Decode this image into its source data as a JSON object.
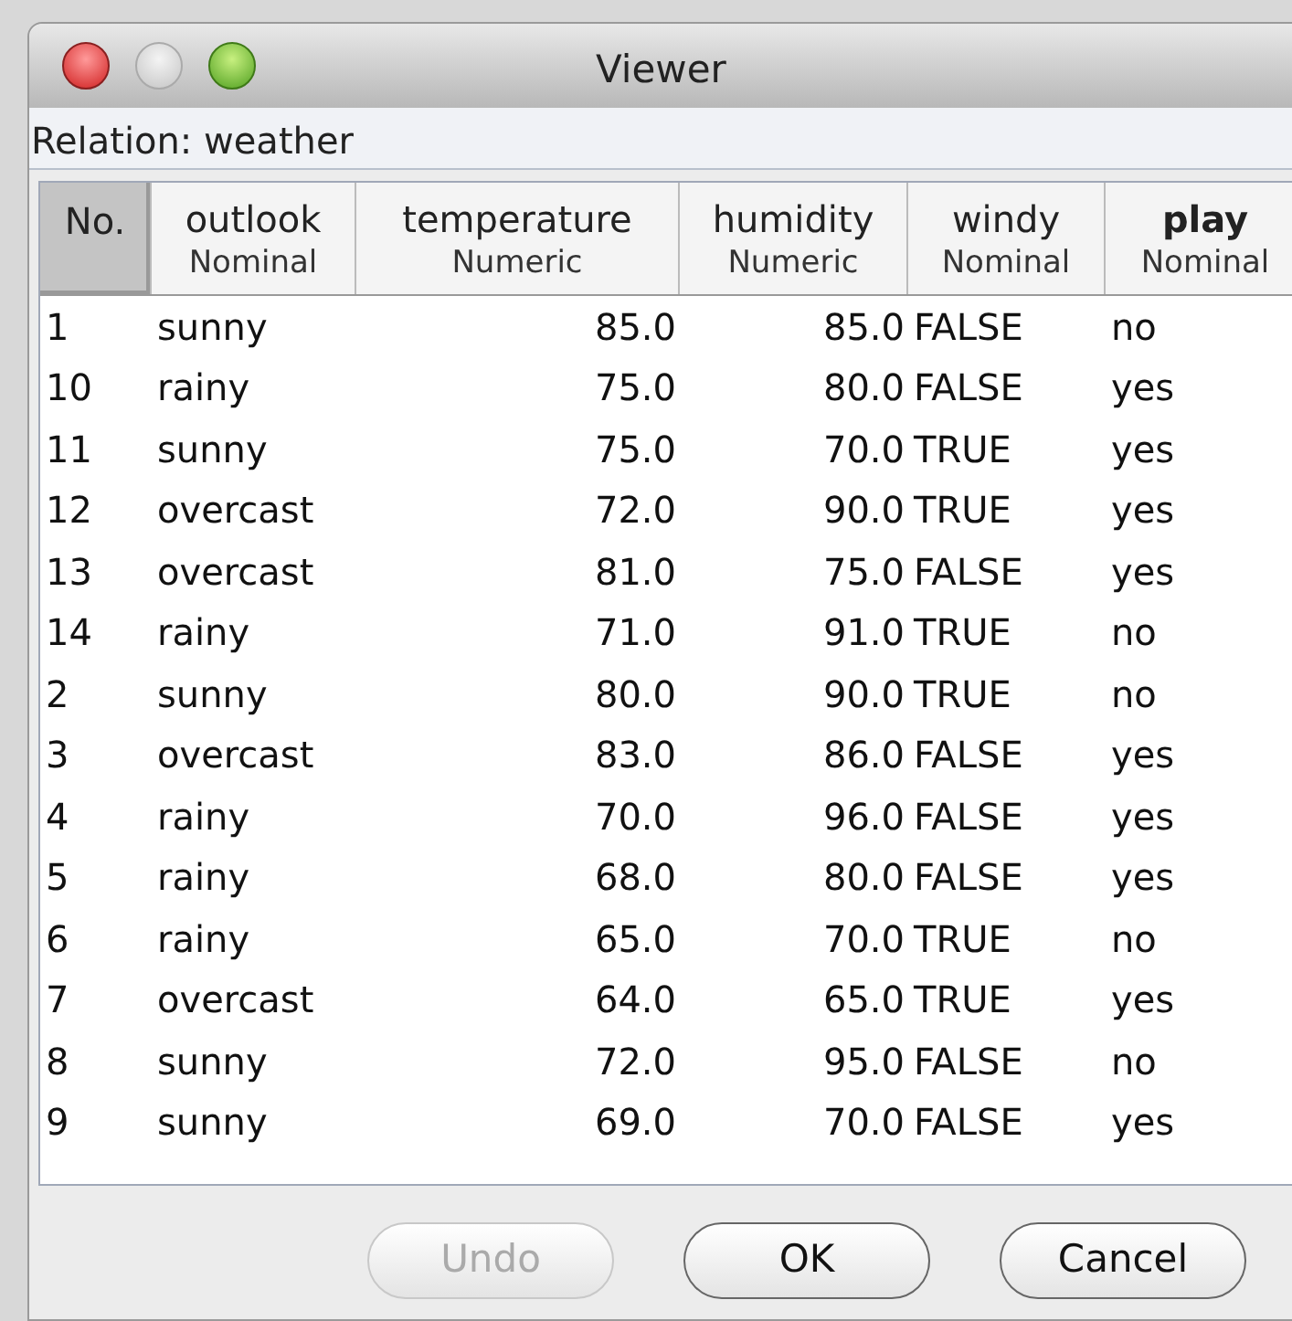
{
  "window": {
    "title": "Viewer"
  },
  "relation": "Relation: weather",
  "table": {
    "columns": [
      {
        "name": "No.",
        "selected": true,
        "bold": false,
        "kind": "index"
      },
      {
        "name": "outlook",
        "type": "Nominal",
        "selected": false,
        "bold": false,
        "kind": "nominal"
      },
      {
        "name": "temperature",
        "type": "Numeric",
        "selected": false,
        "bold": false,
        "kind": "numeric"
      },
      {
        "name": "humidity",
        "type": "Numeric",
        "selected": false,
        "bold": false,
        "kind": "numeric"
      },
      {
        "name": "windy",
        "type": "Nominal",
        "selected": false,
        "bold": false,
        "kind": "nominal"
      },
      {
        "name": "play",
        "type": "Nominal",
        "selected": false,
        "bold": true,
        "kind": "nominal"
      }
    ],
    "rows": [
      [
        "1",
        "sunny",
        "85.0",
        "85.0",
        "FALSE",
        "no"
      ],
      [
        "10",
        "rainy",
        "75.0",
        "80.0",
        "FALSE",
        "yes"
      ],
      [
        "11",
        "sunny",
        "75.0",
        "70.0",
        "TRUE",
        "yes"
      ],
      [
        "12",
        "overcast",
        "72.0",
        "90.0",
        "TRUE",
        "yes"
      ],
      [
        "13",
        "overcast",
        "81.0",
        "75.0",
        "FALSE",
        "yes"
      ],
      [
        "14",
        "rainy",
        "71.0",
        "91.0",
        "TRUE",
        "no"
      ],
      [
        "2",
        "sunny",
        "80.0",
        "90.0",
        "TRUE",
        "no"
      ],
      [
        "3",
        "overcast",
        "83.0",
        "86.0",
        "FALSE",
        "yes"
      ],
      [
        "4",
        "rainy",
        "70.0",
        "96.0",
        "FALSE",
        "yes"
      ],
      [
        "5",
        "rainy",
        "68.0",
        "80.0",
        "FALSE",
        "yes"
      ],
      [
        "6",
        "rainy",
        "65.0",
        "70.0",
        "TRUE",
        "no"
      ],
      [
        "7",
        "overcast",
        "64.0",
        "65.0",
        "TRUE",
        "yes"
      ],
      [
        "8",
        "sunny",
        "72.0",
        "95.0",
        "FALSE",
        "no"
      ],
      [
        "9",
        "sunny",
        "69.0",
        "70.0",
        "FALSE",
        "yes"
      ]
    ]
  },
  "buttons": [
    {
      "label": "Undo",
      "disabled": true
    },
    {
      "label": "OK",
      "disabled": false
    },
    {
      "label": "Cancel",
      "disabled": false
    }
  ]
}
